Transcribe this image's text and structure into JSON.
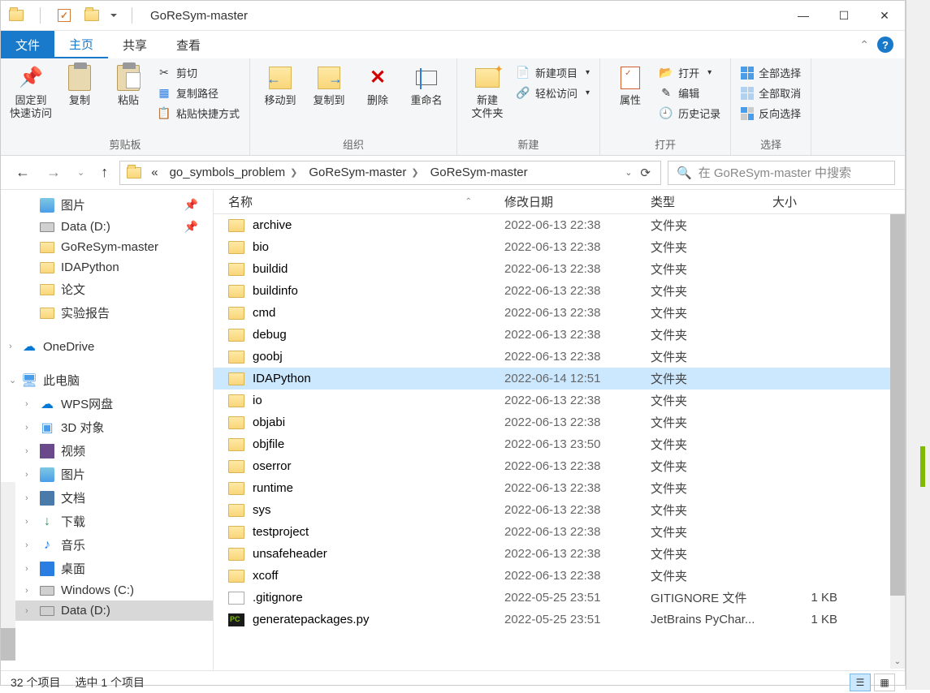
{
  "title": "GoReSym-master",
  "tabs": {
    "file": "文件",
    "home": "主页",
    "share": "共享",
    "view": "查看"
  },
  "ribbon": {
    "clipboard": {
      "label": "剪贴板",
      "pin": "固定到\n快速访问",
      "copy": "复制",
      "paste": "粘贴",
      "cut": "剪切",
      "copypath": "复制路径",
      "pasteshortcut": "粘贴快捷方式"
    },
    "organize": {
      "label": "组织",
      "moveto": "移动到",
      "copyto": "复制到",
      "delete": "删除",
      "rename": "重命名"
    },
    "new": {
      "label": "新建",
      "newfolder": "新建\n文件夹",
      "newitem": "新建项目",
      "easyaccess": "轻松访问"
    },
    "open": {
      "label": "打开",
      "properties": "属性",
      "open": "打开",
      "edit": "编辑",
      "history": "历史记录"
    },
    "select": {
      "label": "选择",
      "selectall": "全部选择",
      "selectnone": "全部取消",
      "invert": "反向选择"
    }
  },
  "breadcrumbs": [
    "go_symbols_problem",
    "GoReSym-master",
    "GoReSym-master"
  ],
  "search_placeholder": "在 GoReSym-master 中搜索",
  "sidebar": {
    "quick": [
      {
        "label": "图片",
        "icon": "pic",
        "pinned": true
      },
      {
        "label": "Data (D:)",
        "icon": "drive",
        "pinned": true
      },
      {
        "label": "GoReSym-master",
        "icon": "folder"
      },
      {
        "label": "IDAPython",
        "icon": "folder"
      },
      {
        "label": "论文",
        "icon": "folder"
      },
      {
        "label": "实验报告",
        "icon": "folder"
      }
    ],
    "onedrive": "OneDrive",
    "thispc": "此电脑",
    "pc_items": [
      {
        "label": "WPS网盘",
        "icon": "onedrive"
      },
      {
        "label": "3D 对象",
        "icon": "3d"
      },
      {
        "label": "视频",
        "icon": "video"
      },
      {
        "label": "图片",
        "icon": "pic"
      },
      {
        "label": "文档",
        "icon": "doc"
      },
      {
        "label": "下载",
        "icon": "down"
      },
      {
        "label": "音乐",
        "icon": "music"
      },
      {
        "label": "桌面",
        "icon": "desktop"
      },
      {
        "label": "Windows (C:)",
        "icon": "drive"
      },
      {
        "label": "Data (D:)",
        "icon": "drive",
        "selected": true
      }
    ]
  },
  "columns": {
    "name": "名称",
    "date": "修改日期",
    "type": "类型",
    "size": "大小"
  },
  "files": [
    {
      "name": "archive",
      "date": "2022-06-13 22:38",
      "type": "文件夹",
      "icon": "folder"
    },
    {
      "name": "bio",
      "date": "2022-06-13 22:38",
      "type": "文件夹",
      "icon": "folder"
    },
    {
      "name": "buildid",
      "date": "2022-06-13 22:38",
      "type": "文件夹",
      "icon": "folder"
    },
    {
      "name": "buildinfo",
      "date": "2022-06-13 22:38",
      "type": "文件夹",
      "icon": "folder"
    },
    {
      "name": "cmd",
      "date": "2022-06-13 22:38",
      "type": "文件夹",
      "icon": "folder"
    },
    {
      "name": "debug",
      "date": "2022-06-13 22:38",
      "type": "文件夹",
      "icon": "folder"
    },
    {
      "name": "goobj",
      "date": "2022-06-13 22:38",
      "type": "文件夹",
      "icon": "folder"
    },
    {
      "name": "IDAPython",
      "date": "2022-06-14 12:51",
      "type": "文件夹",
      "icon": "folder",
      "selected": true
    },
    {
      "name": "io",
      "date": "2022-06-13 22:38",
      "type": "文件夹",
      "icon": "folder"
    },
    {
      "name": "objabi",
      "date": "2022-06-13 22:38",
      "type": "文件夹",
      "icon": "folder"
    },
    {
      "name": "objfile",
      "date": "2022-06-13 23:50",
      "type": "文件夹",
      "icon": "folder"
    },
    {
      "name": "oserror",
      "date": "2022-06-13 22:38",
      "type": "文件夹",
      "icon": "folder"
    },
    {
      "name": "runtime",
      "date": "2022-06-13 22:38",
      "type": "文件夹",
      "icon": "folder"
    },
    {
      "name": "sys",
      "date": "2022-06-13 22:38",
      "type": "文件夹",
      "icon": "folder"
    },
    {
      "name": "testproject",
      "date": "2022-06-13 22:38",
      "type": "文件夹",
      "icon": "folder"
    },
    {
      "name": "unsafeheader",
      "date": "2022-06-13 22:38",
      "type": "文件夹",
      "icon": "folder"
    },
    {
      "name": "xcoff",
      "date": "2022-06-13 22:38",
      "type": "文件夹",
      "icon": "folder"
    },
    {
      "name": ".gitignore",
      "date": "2022-05-25 23:51",
      "type": "GITIGNORE 文件",
      "size": "1 KB",
      "icon": "git"
    },
    {
      "name": "generatepackages.py",
      "date": "2022-05-25 23:51",
      "type": "JetBrains PyChar...",
      "size": "1 KB",
      "icon": "py"
    }
  ],
  "status": {
    "count": "32 个项目",
    "selected": "选中 1 个项目"
  }
}
